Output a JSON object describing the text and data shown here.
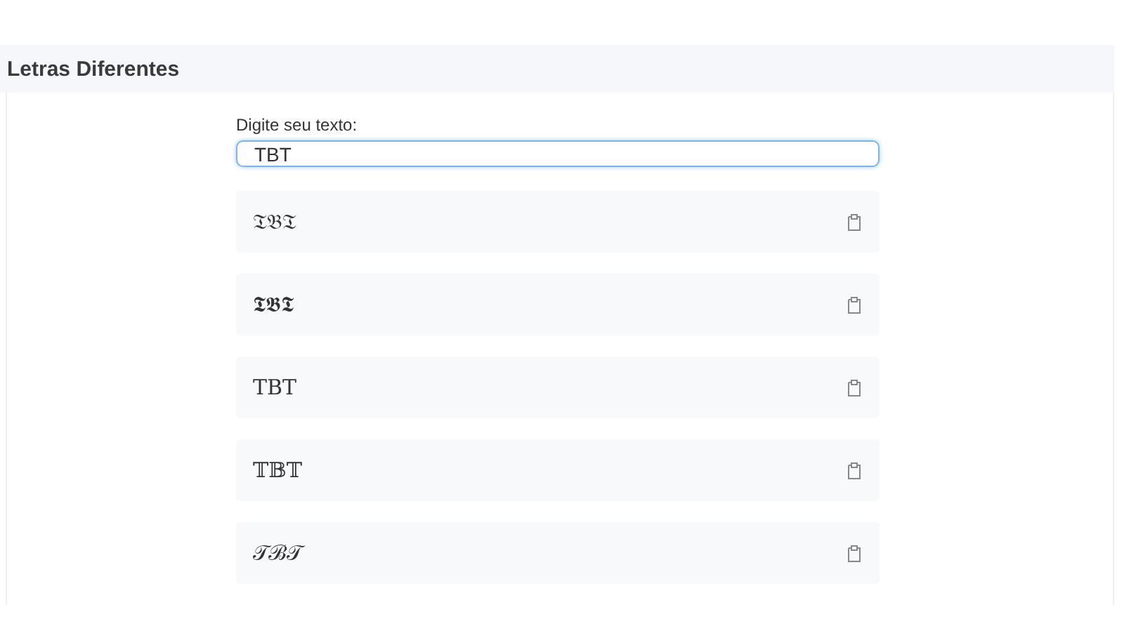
{
  "header": {
    "title": "Letras Diferentes"
  },
  "input": {
    "label": "Digite seu texto:",
    "value": "TBT"
  },
  "results": [
    {
      "text": "𝔗𝔅𝔗"
    },
    {
      "text": "𝕿𝕭𝕿"
    },
    {
      "text": "TBT"
    },
    {
      "text": "𝕋𝔹𝕋"
    },
    {
      "text": "𝒯ℬ𝒯"
    }
  ]
}
